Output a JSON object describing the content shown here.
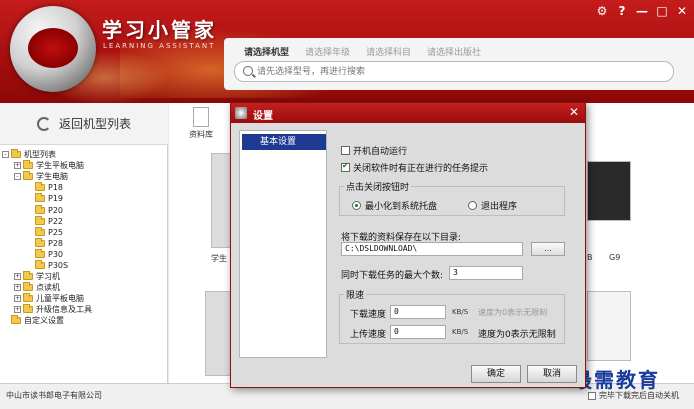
{
  "app": {
    "name_cn": "学习小管家",
    "name_en": "LEARNING ASSISTANT",
    "window_controls": [
      "⚙",
      "?",
      "—",
      "□",
      "✕"
    ]
  },
  "search": {
    "tabs": [
      "请选择机型",
      "请选择年级",
      "请选择科目",
      "请选择出版社"
    ],
    "placeholder": "请先选择型号，再进行搜索"
  },
  "sidebar": {
    "back_label": "返回机型列表",
    "tree": [
      {
        "label": "机型列表",
        "level": 0,
        "toggle": "-"
      },
      {
        "label": "学生平板电脑",
        "level": 1,
        "toggle": "+"
      },
      {
        "label": "学生电脑",
        "level": 1,
        "toggle": "-"
      },
      {
        "label": "P18",
        "level": 2,
        "toggle": ""
      },
      {
        "label": "P19",
        "level": 2,
        "toggle": ""
      },
      {
        "label": "P20",
        "level": 2,
        "toggle": ""
      },
      {
        "label": "P22",
        "level": 2,
        "toggle": ""
      },
      {
        "label": "P25",
        "level": 2,
        "toggle": ""
      },
      {
        "label": "P28",
        "level": 2,
        "toggle": ""
      },
      {
        "label": "P30",
        "level": 2,
        "toggle": ""
      },
      {
        "label": "P30S",
        "level": 2,
        "toggle": ""
      },
      {
        "label": "学习机",
        "level": 1,
        "toggle": "+"
      },
      {
        "label": "点读机",
        "level": 1,
        "toggle": "+"
      },
      {
        "label": "儿童平板电脑",
        "level": 1,
        "toggle": "+"
      },
      {
        "label": "升级信息及工具",
        "level": 1,
        "toggle": "+"
      },
      {
        "label": "自定义设置",
        "level": 0,
        "toggle": ""
      }
    ]
  },
  "main": {
    "doc_lib_label": "资料库",
    "partial_label_left": "学生",
    "partial_label_right1": "B",
    "partial_label_right2": "G9"
  },
  "status": {
    "company": "中山市读书郎电子有限公司",
    "auto_close": "完毕下载完后自动关机"
  },
  "watermark": "最需教育",
  "dialog": {
    "title": "设置",
    "nav": [
      "基本设置"
    ],
    "autostart_label": "开机自动运行",
    "autostart_checked": false,
    "close_prompt_label": "关闭软件时有正在进行的任务提示",
    "close_prompt_checked": true,
    "close_group_label": "点击关闭按钮时",
    "radio_minimize": "最小化到系统托盘",
    "radio_exit": "退出程序",
    "radio_selected": "minimize",
    "save_dir_label": "将下载的资料保存在以下目录:",
    "save_dir_value": "C:\\DSLDOWNLOAD\\",
    "browse_label": "...",
    "max_tasks_label": "同时下载任务的最大个数:",
    "max_tasks_value": "3",
    "speed_group_label": "限速",
    "download_speed_label": "下载速度",
    "download_speed_value": "0",
    "upload_speed_label": "上传速度",
    "upload_speed_value": "0",
    "speed_unit": "KB/S",
    "download_hint": "速度为0表示无限制",
    "upload_hint": "速度为0表示无限制",
    "ok_label": "确定",
    "cancel_label": "取消"
  },
  "colors": {
    "header_red": "#b31414",
    "nav_selected": "#1e3a93",
    "watermark_blue": "#1a3a9c"
  }
}
